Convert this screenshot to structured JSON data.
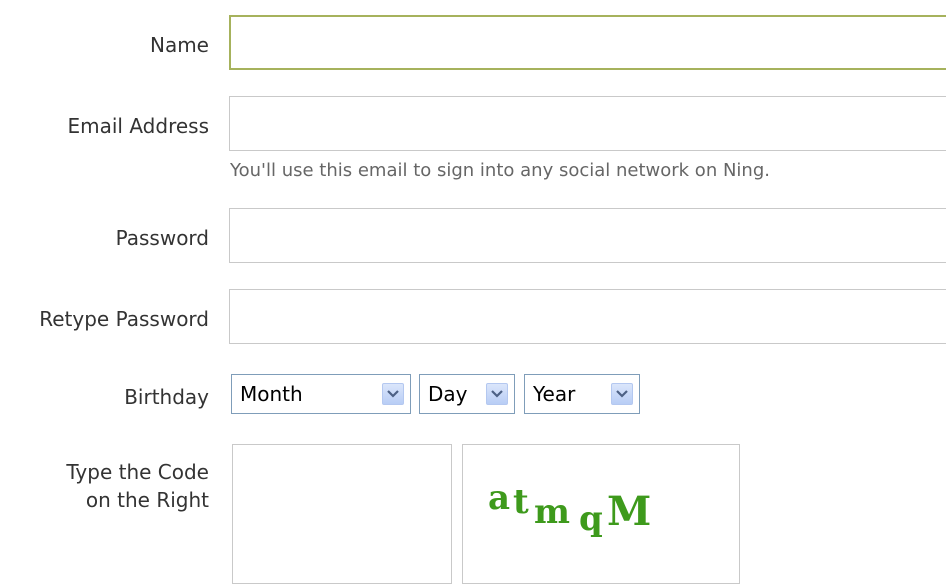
{
  "form": {
    "name": {
      "label": "Name",
      "value": ""
    },
    "email": {
      "label": "Email Address",
      "value": "",
      "hint": "You'll use this email to sign into any social network on Ning."
    },
    "password": {
      "label": "Password",
      "value": ""
    },
    "retype_password": {
      "label": "Retype Password",
      "value": ""
    },
    "birthday": {
      "label": "Birthday",
      "month": "Month",
      "day": "Day",
      "year": "Year"
    },
    "captcha": {
      "label_line1": "Type the Code",
      "label_line2": "on the Right",
      "value": "",
      "code": "atmqM",
      "code_chars": [
        "a",
        "t",
        "m",
        "q",
        "M"
      ],
      "code_color": "#3e9a1c"
    }
  },
  "icons": {
    "dropdown": "chevron-down-icon"
  }
}
